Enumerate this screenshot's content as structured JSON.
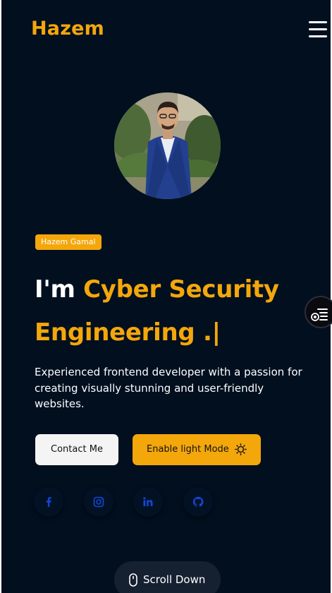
{
  "header": {
    "logo": "Hazem",
    "menu_icon": "hamburger-menu-icon"
  },
  "hero": {
    "badge": "Hazem Gamal",
    "headline_prefix": "I'm ",
    "headline_role": "Cyber Security Engineering .|",
    "description": "Experienced frontend developer with a passion for creating visually stunning and user-friendly websites.",
    "contact_label": "Contact Me",
    "light_mode_label": "Enable light Mode",
    "light_mode_icon": "sun-icon"
  },
  "social": [
    {
      "name": "facebook",
      "icon": "facebook-icon"
    },
    {
      "name": "instagram",
      "icon": "instagram-icon"
    },
    {
      "name": "linkedin",
      "icon": "linkedin-icon"
    },
    {
      "name": "github",
      "icon": "github-icon"
    }
  ],
  "floating": {
    "icon": "user-list-icon"
  },
  "scroll": {
    "label": "Scroll Down",
    "icon": "mouse-icon"
  },
  "colors": {
    "background": "#010f1f",
    "accent": "#f4a70b",
    "text": "#ffffff",
    "social_icon": "#1446d6"
  }
}
